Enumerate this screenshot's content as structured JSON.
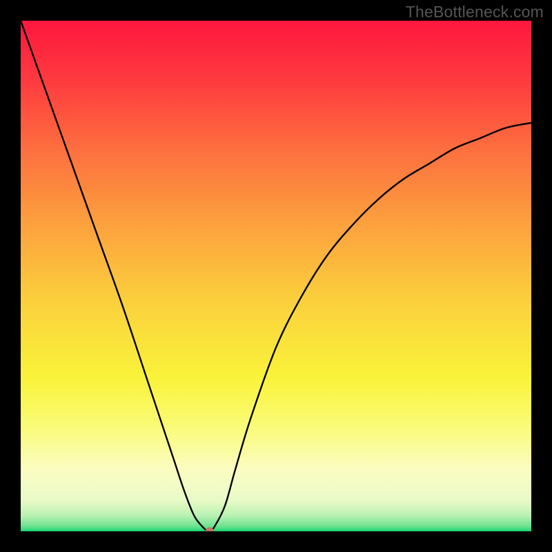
{
  "watermark": "TheBottleneck.com",
  "chart_data": {
    "type": "line",
    "title": "",
    "xlabel": "",
    "ylabel": "",
    "xlim": [
      0,
      100
    ],
    "ylim": [
      0,
      100
    ],
    "grid": false,
    "legend": false,
    "background_gradient": {
      "type": "vertical",
      "stops": [
        {
          "pos": 0.0,
          "color": "#fe173e"
        },
        {
          "pos": 0.12,
          "color": "#fe3b3f"
        },
        {
          "pos": 0.25,
          "color": "#fd6e3f"
        },
        {
          "pos": 0.4,
          "color": "#fca13e"
        },
        {
          "pos": 0.55,
          "color": "#fbd03c"
        },
        {
          "pos": 0.7,
          "color": "#f9f33a"
        },
        {
          "pos": 0.8,
          "color": "#fafb7b"
        },
        {
          "pos": 0.88,
          "color": "#fbfdc2"
        },
        {
          "pos": 0.94,
          "color": "#e8fac7"
        },
        {
          "pos": 0.97,
          "color": "#b9f1b2"
        },
        {
          "pos": 0.99,
          "color": "#6de28f"
        },
        {
          "pos": 1.0,
          "color": "#18d672"
        }
      ]
    },
    "series": [
      {
        "name": "bottleneck-curve",
        "x": [
          0,
          5,
          10,
          15,
          20,
          25,
          28,
          30,
          32,
          34,
          36,
          37,
          38,
          40,
          42,
          45,
          50,
          55,
          60,
          65,
          70,
          75,
          80,
          85,
          90,
          95,
          100
        ],
        "values": [
          100,
          86,
          72,
          58,
          44,
          29,
          20,
          14,
          8,
          3,
          0.5,
          0,
          1,
          5,
          12,
          22,
          36,
          46,
          54,
          60,
          65,
          69,
          72,
          75,
          77,
          79,
          80
        ]
      }
    ],
    "marker": {
      "x": 37,
      "y": 0,
      "color": "#c17468",
      "radius": 6
    }
  }
}
